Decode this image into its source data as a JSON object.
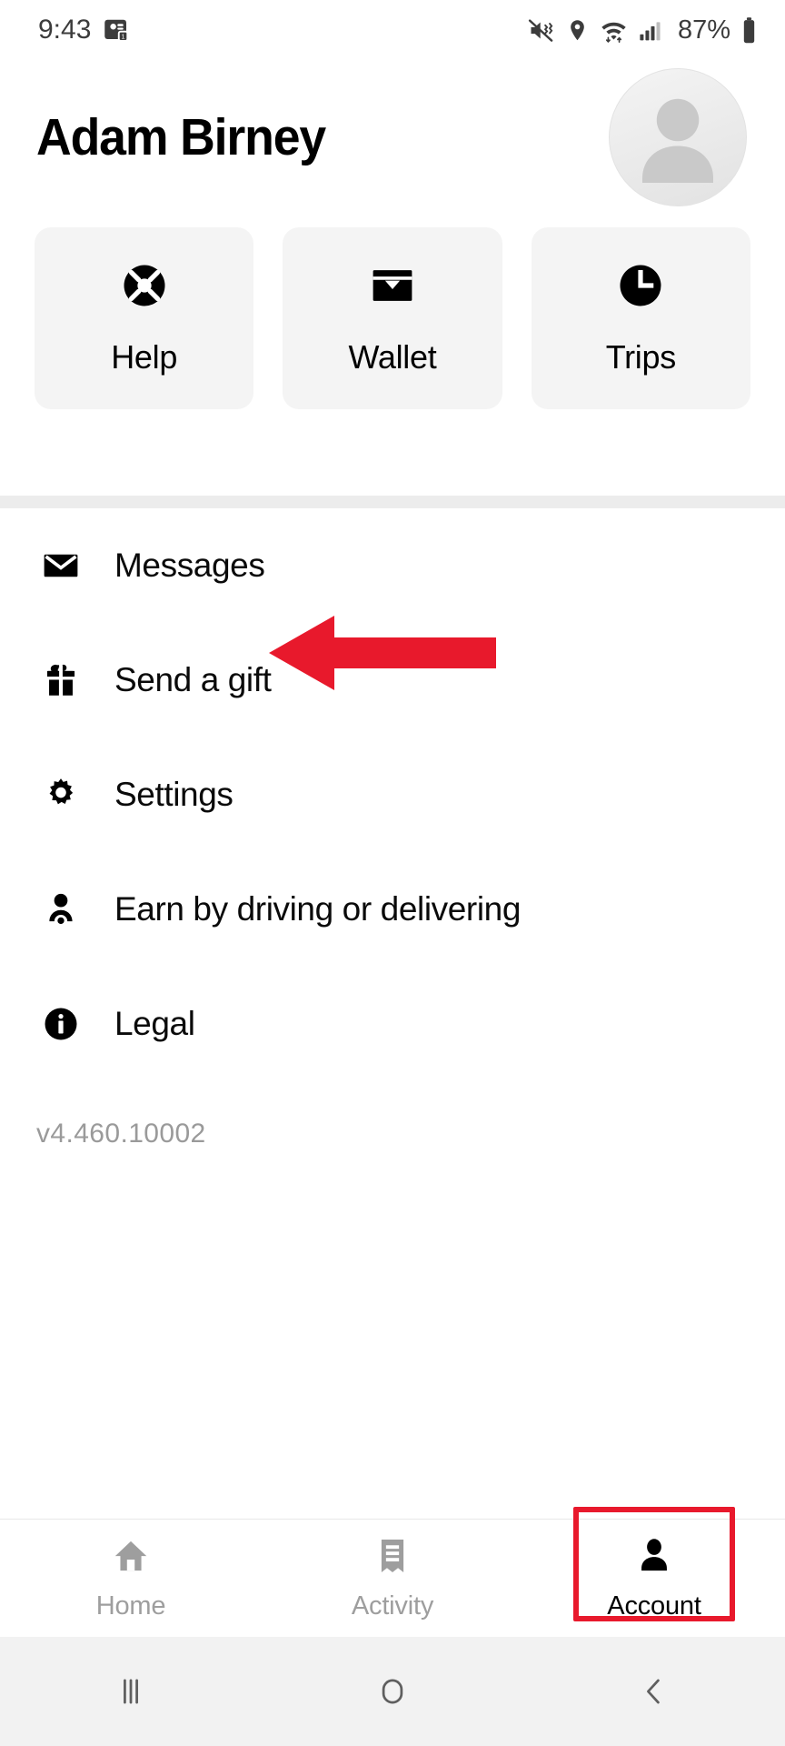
{
  "status_bar": {
    "time": "9:43",
    "left_icons": [
      "screen-capture-icon"
    ],
    "right_icons": [
      "mute-icon",
      "location-icon",
      "wifi-icon",
      "cellular-signal-icon"
    ],
    "battery_percent": "87%"
  },
  "header": {
    "user_name": "Adam Birney",
    "avatar": "default-avatar-icon"
  },
  "quick_actions": [
    {
      "label": "Help",
      "icon": "life-ring-icon"
    },
    {
      "label": "Wallet",
      "icon": "wallet-icon"
    },
    {
      "label": "Trips",
      "icon": "clock-icon"
    }
  ],
  "menu": {
    "items": [
      {
        "label": "Messages",
        "icon": "envelope-icon"
      },
      {
        "label": "Send a gift",
        "icon": "gift-icon"
      },
      {
        "label": "Settings",
        "icon": "gear-icon"
      },
      {
        "label": "Earn by driving or delivering",
        "icon": "person-icon"
      },
      {
        "label": "Legal",
        "icon": "info-circle-icon"
      }
    ],
    "version": "v4.460.10002"
  },
  "annotation": {
    "arrow_color": "#e8192c",
    "arrow_target": "Settings",
    "highlight_color": "#e8192c",
    "highlight_target": "Account"
  },
  "bottom_nav": {
    "tabs": [
      {
        "label": "Home",
        "icon": "home-icon",
        "active": false
      },
      {
        "label": "Activity",
        "icon": "receipt-icon",
        "active": false
      },
      {
        "label": "Account",
        "icon": "person-filled-icon",
        "active": true
      }
    ]
  },
  "system_nav": {
    "buttons": [
      "recents-icon",
      "home-icon",
      "back-icon"
    ]
  }
}
